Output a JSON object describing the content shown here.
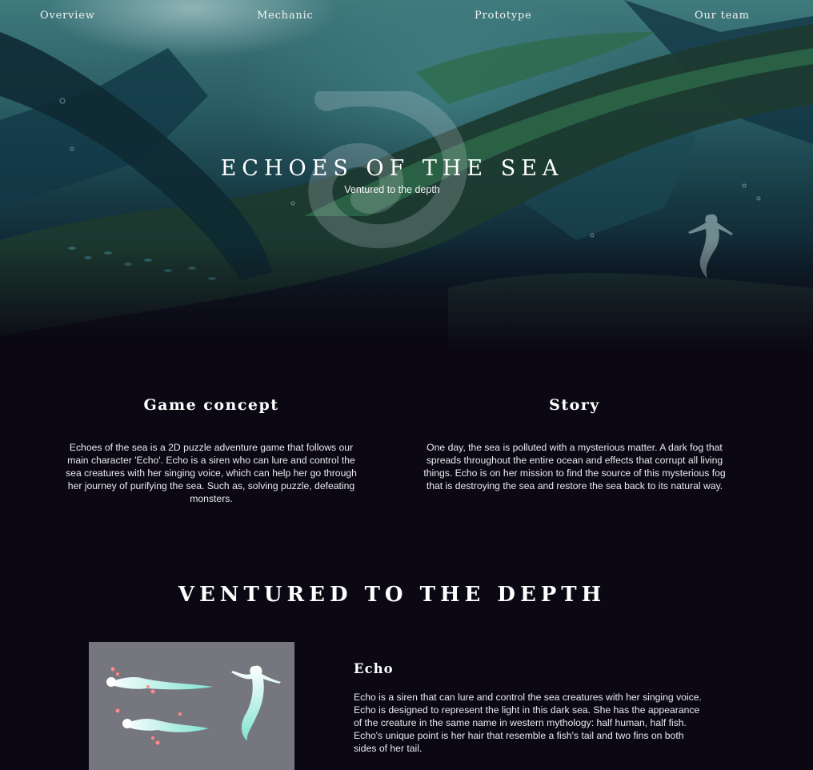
{
  "nav": {
    "items": [
      {
        "label": "Overview"
      },
      {
        "label": "Mechanic"
      },
      {
        "label": "Prototype"
      },
      {
        "label": "Our team"
      }
    ]
  },
  "hero": {
    "title": "ECHOES OF THE SEA",
    "subtitle": "Ventured to the depth",
    "logo_icon": "swirl-logo-icon",
    "accent_color": "#2f6a6f"
  },
  "concept": {
    "title": "Game concept",
    "text": "Echoes of the sea is a 2D puzzle adventure game that follows our main character 'Echo'. Echo is a siren who can lure and control the sea creatures with her singing voice, which can help her go through her journey of purifying the sea. Such as, solving puzzle, defeating monsters."
  },
  "story": {
    "title": "Story",
    "text": "One day, the sea is polluted with a mysterious matter. A dark fog that spreads throughout the entire ocean and effects that corrupt all living things. Echo is on her mission to find the source of this mysterious fog that is destroying the sea and restore the sea back to its natural way."
  },
  "depth": {
    "title": "VENTURED TO THE DEPTH"
  },
  "character": {
    "name": "Echo",
    "description": "Echo is a siren that can lure and control the sea creatures with her singing voice. Echo is designed to represent the light in this dark sea. She has the appearance of the creature in the same name in western mythology: half human, half fish. Echo's unique point is her hair that resemble a fish's tail and two fins on both sides of her tail.",
    "image_icon": "siren-sprite-sheet"
  },
  "colors": {
    "background": "#0b0813",
    "text": "#ffffff",
    "sprite_bg": "#76767f",
    "siren_glow": "#7fe3d2"
  }
}
